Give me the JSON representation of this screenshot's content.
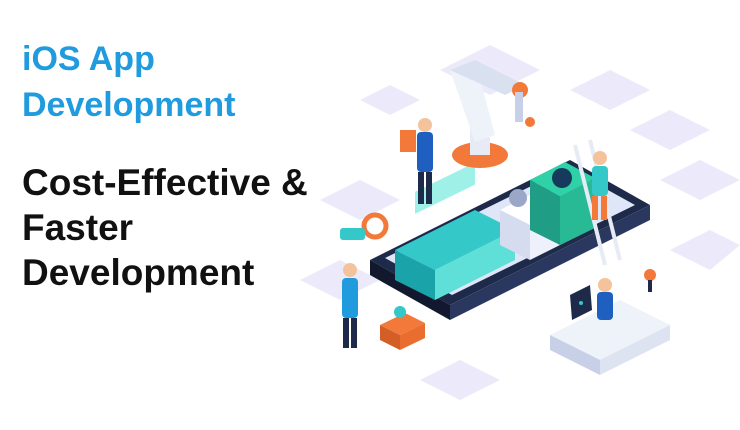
{
  "heading": {
    "line1": "iOS App",
    "line2": "Development"
  },
  "subheading": {
    "line1": "Cost-Effective &",
    "line2": "Faster",
    "line3": "Development"
  },
  "illustration": {
    "name": "isometric-ios-development-scene",
    "colors": {
      "accent_blue": "#1f9bde",
      "phone_dark": "#1e2a4a",
      "screen_teal": "#34c8c8",
      "orange": "#f2793a",
      "tile_lavender": "#eceafa"
    }
  }
}
